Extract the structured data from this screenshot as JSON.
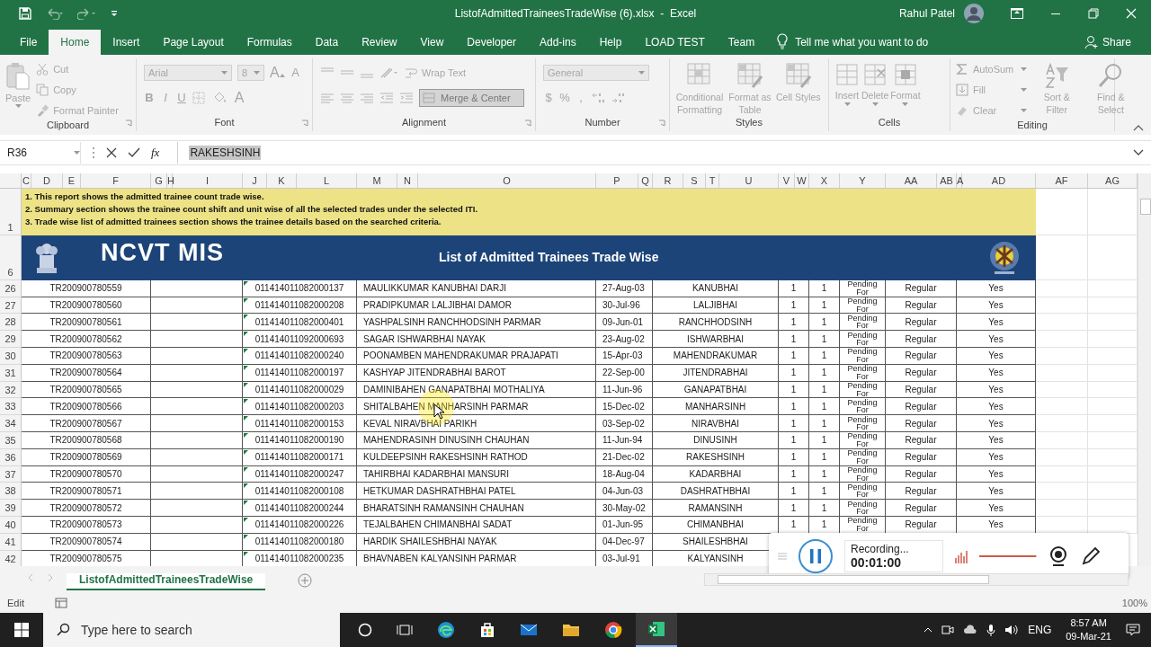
{
  "title_bar": {
    "file_title": "ListofAdmittedTraineesTradeWise (6).xlsx  -  Excel",
    "user_name": "Rahul Patel"
  },
  "menu_tabs": [
    {
      "label": "File",
      "selected": false
    },
    {
      "label": "Home",
      "selected": true
    },
    {
      "label": "Insert",
      "selected": false
    },
    {
      "label": "Page Layout",
      "selected": false
    },
    {
      "label": "Formulas",
      "selected": false
    },
    {
      "label": "Data",
      "selected": false
    },
    {
      "label": "Review",
      "selected": false
    },
    {
      "label": "View",
      "selected": false
    },
    {
      "label": "Developer",
      "selected": false
    },
    {
      "label": "Add-ins",
      "selected": false
    },
    {
      "label": "Help",
      "selected": false
    },
    {
      "label": "LOAD TEST",
      "selected": false
    },
    {
      "label": "Team",
      "selected": false
    }
  ],
  "tell_me": {
    "placeholder": "Tell me what you want to do"
  },
  "share": "Share",
  "ribbon": {
    "disabled": true,
    "clipboard": {
      "label": "Clipboard",
      "paste": "Paste",
      "cut": "Cut",
      "copy": "Copy",
      "format_painter": "Format Painter"
    },
    "font": {
      "label": "Font",
      "font_name": "Arial",
      "font_size": "8",
      "grow_font": "A",
      "shrink_font": "A",
      "style_buttons": [
        "B",
        "I",
        "U"
      ],
      "font_color": "A"
    },
    "alignment": {
      "label": "Alignment",
      "wrap_text": "Wrap Text",
      "merge_center": "Merge & Center"
    },
    "number": {
      "label": "Number",
      "format": "General",
      "currency": "$",
      "percent": "%",
      "comma": ","
    },
    "styles": {
      "label": "Styles",
      "buttons": [
        "Conditional Formatting",
        "Format as Table",
        "Cell Styles"
      ]
    },
    "cells": {
      "label": "Cells",
      "buttons": [
        "Insert",
        "Delete",
        "Format"
      ]
    },
    "editing": {
      "label": "Editing",
      "autosum": "AutoSum",
      "fill": "Fill",
      "clear": "Clear",
      "sort_filter": "Sort & Filter",
      "find_select": "Find & Select"
    }
  },
  "formula_bar": {
    "name_box": "R36",
    "function_label": "fx",
    "value": "RAKESHSINH"
  },
  "sheet": {
    "column_headers": [
      "C",
      "D",
      "E",
      "F",
      "G",
      "H",
      "I",
      "J",
      "K",
      "L",
      "M",
      "N",
      "O",
      "P",
      "Q",
      "R",
      "S",
      "T",
      "U",
      "V",
      "W",
      "X",
      "Y",
      "AA",
      "AB",
      "A",
      "AD",
      "AF",
      "AG"
    ],
    "notes_row": "1",
    "notes": [
      "1. This report shows the admitted trainee count trade wise.",
      "2. Summary section shows the trainee count shift and unit wise of all the selected trades under the selected ITI.",
      "3. Trade wise list of admitted trainees section shows the trainee details based on the searched criteria."
    ],
    "banner_row": "6",
    "banner": {
      "logo_text": "NCVT MIS",
      "title": "List of Admitted Trainees Trade Wise"
    },
    "rows": [
      {
        "row": "26",
        "cells": [
          "TR200900780559",
          "011414011082000137",
          "MAULIKKUMAR KANUBHAI DARJI",
          "27-Aug-03",
          "KANUBHAI",
          "1",
          "1",
          "Pending For",
          "Regular",
          "Yes"
        ]
      },
      {
        "row": "27",
        "cells": [
          "TR200900780560",
          "011414011082000208",
          "PRADIPKUMAR  LALJIBHAI  DAMOR",
          "30-Jul-96",
          "LALJIBHAI",
          "1",
          "1",
          "Pending For",
          "Regular",
          "Yes"
        ]
      },
      {
        "row": "28",
        "cells": [
          "TR200900780561",
          "011414011082000401",
          "YASHPALSINH RANCHHODSINH PARMAR",
          "09-Jun-01",
          "RANCHHODSINH",
          "1",
          "1",
          "Pending For",
          "Regular",
          "Yes"
        ]
      },
      {
        "row": "29",
        "cells": [
          "TR200900780562",
          "011414011092000693",
          "SAGAR ISHWARBHAI NAYAK",
          "23-Aug-02",
          "ISHWARBHAI",
          "1",
          "1",
          "Pending For",
          "Regular",
          "Yes"
        ]
      },
      {
        "row": "30",
        "cells": [
          "TR200900780563",
          "011414011082000240",
          "POONAMBEN MAHENDRAKUMAR PRAJAPATI",
          "15-Apr-03",
          "MAHENDRAKUMAR",
          "1",
          "1",
          "Pending For",
          "Regular",
          "Yes"
        ]
      },
      {
        "row": "31",
        "cells": [
          "TR200900780564",
          "011414011082000197",
          "KASHYAP JITENDRABHAI BAROT",
          "22-Sep-00",
          "JITENDRABHAI",
          "1",
          "1",
          "Pending For",
          "Regular",
          "Yes"
        ]
      },
      {
        "row": "32",
        "cells": [
          "TR200900780565",
          "011414011082000029",
          "DAMINIBAHEN GANAPATBHAI MOTHALIYA",
          "11-Jun-96",
          "GANAPATBHAI",
          "1",
          "1",
          "Pending For",
          "Regular",
          "Yes"
        ]
      },
      {
        "row": "33",
        "cells": [
          "TR200900780566",
          "011414011082000203",
          "SHITALBAHEN MANHARSINH PARMAR",
          "15-Dec-02",
          "MANHARSINH",
          "1",
          "1",
          "Pending For",
          "Regular",
          "Yes"
        ]
      },
      {
        "row": "34",
        "cells": [
          "TR200900780567",
          "011414011082000153",
          "KEVAL NIRAVBHAI PARIKH",
          "03-Sep-02",
          "NIRAVBHAI",
          "1",
          "1",
          "Pending For",
          "Regular",
          "Yes"
        ]
      },
      {
        "row": "35",
        "cells": [
          "TR200900780568",
          "011414011082000190",
          "MAHENDRASINH DINUSINH CHAUHAN",
          "11-Jun-94",
          "DINUSINH",
          "1",
          "1",
          "Pending For",
          "Regular",
          "Yes"
        ]
      },
      {
        "row": "36",
        "cells": [
          "TR200900780569",
          "011414011082000171",
          "KULDEEPSINH RAKESHSINH RATHOD",
          "21-Dec-02",
          "RAKESHSINH",
          "1",
          "1",
          "Pending For",
          "Regular",
          "Yes"
        ]
      },
      {
        "row": "37",
        "cells": [
          "TR200900780570",
          "011414011082000247",
          "TAHIRBHAI KADARBHAI MANSURI",
          "18-Aug-04",
          "KADARBHAI",
          "1",
          "1",
          "Pending For",
          "Regular",
          "Yes"
        ]
      },
      {
        "row": "38",
        "cells": [
          "TR200900780571",
          "011414011082000108",
          "HETKUMAR DASHRATHBHAI PATEL",
          "04-Jun-03",
          "DASHRATHBHAI",
          "1",
          "1",
          "Pending For",
          "Regular",
          "Yes"
        ]
      },
      {
        "row": "39",
        "cells": [
          "TR200900780572",
          "011414011082000244",
          "BHARATSINH RAMANSINH CHAUHAN",
          "30-May-02",
          "RAMANSINH",
          "1",
          "1",
          "Pending For",
          "Regular",
          "Yes"
        ]
      },
      {
        "row": "40",
        "cells": [
          "TR200900780573",
          "011414011082000226",
          "TEJALBAHEN CHIMANBHAI SADAT",
          "01-Jun-95",
          "CHIMANBHAI",
          "1",
          "1",
          "Pending For",
          "Regular",
          "Yes"
        ]
      },
      {
        "row": "41",
        "cells": [
          "TR200900780574",
          "011414011082000180",
          "HARDIK SHAILESHBHAI NAYAK",
          "04-Dec-97",
          "SHAILESHBHAI"
        ]
      },
      {
        "row": "42",
        "cells": [
          "TR200900780575",
          "011414011082000235",
          "BHAVNABEN KALYANSINH PARMAR",
          "03-Jul-91",
          "KALYANSINH"
        ]
      }
    ]
  },
  "sheet_tabs": [
    {
      "label": "ListofAdmittedTraineesTradeWise",
      "selected": true
    }
  ],
  "status_bar": {
    "mode": "Edit",
    "zoom": "100%"
  },
  "recorder": {
    "status": "Recording...",
    "time": "00:01:00",
    "volume": {
      "level": 0.95
    }
  },
  "taskbar": {
    "search_placeholder": "Type here to search",
    "language": "ENG",
    "time": "8:57 AM",
    "date": "09-Mar-21"
  }
}
